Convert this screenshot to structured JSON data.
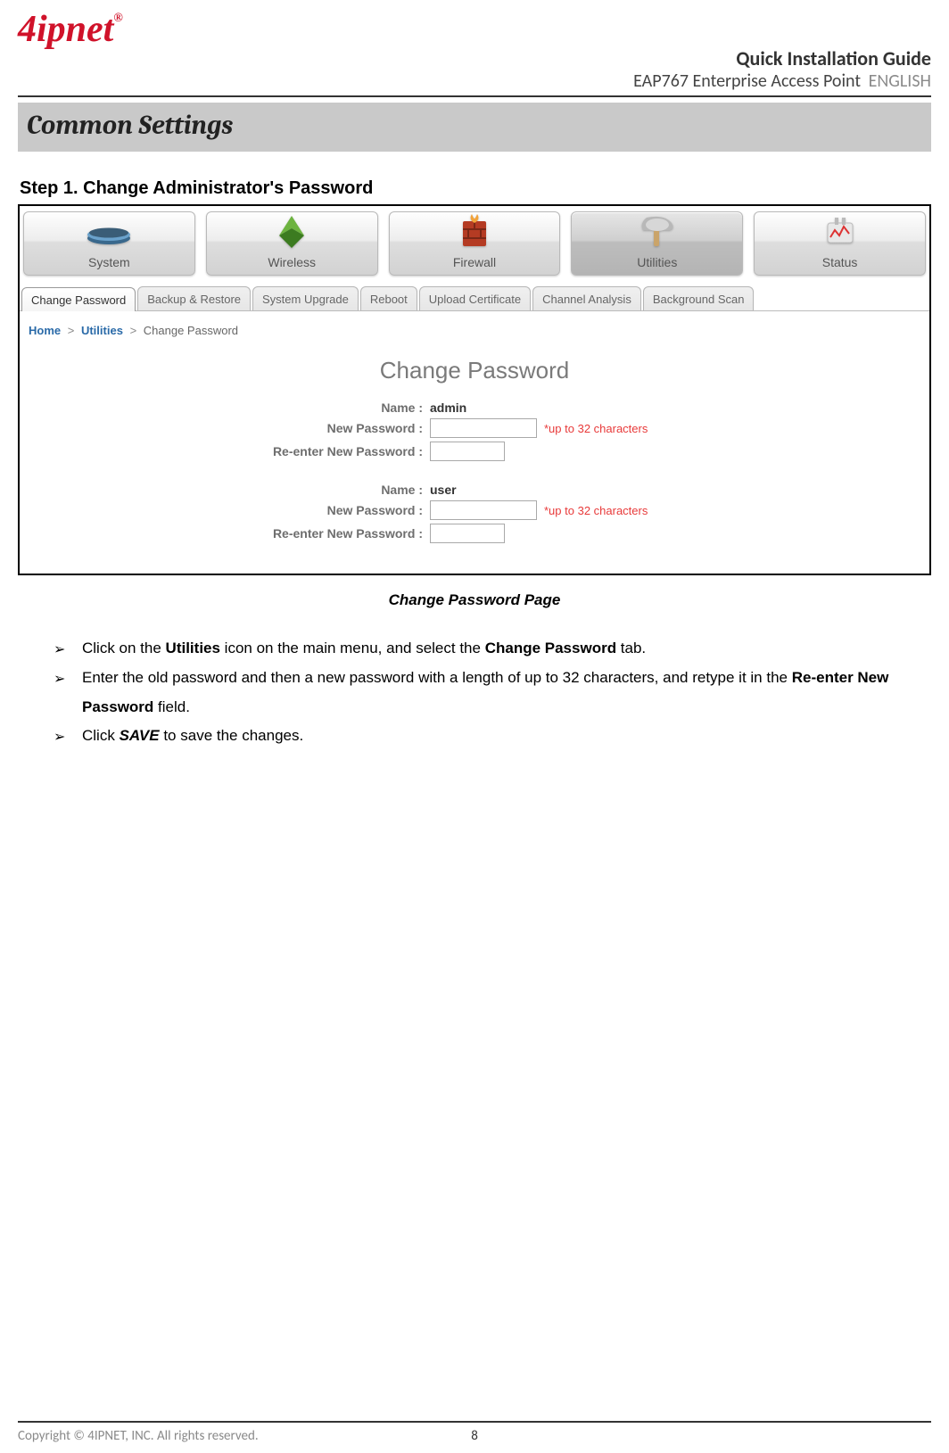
{
  "brand": "4ipnet",
  "brand_tm": "®",
  "header": {
    "qig": "Quick Installation Guide",
    "product": "EAP767 Enterprise Access Point",
    "lang": "ENGLISH"
  },
  "section_title": "Common Settings",
  "step_title": "Step 1. Change Administrator's Password",
  "nav": {
    "items": [
      {
        "label": "System"
      },
      {
        "label": "Wireless"
      },
      {
        "label": "Firewall"
      },
      {
        "label": "Utilities"
      },
      {
        "label": "Status"
      }
    ]
  },
  "tabs": [
    "Change Password",
    "Backup & Restore",
    "System Upgrade",
    "Reboot",
    "Upload Certificate",
    "Channel Analysis",
    "Background Scan"
  ],
  "breadcrumb": {
    "home": "Home",
    "mid": "Utilities",
    "tail": "Change Password"
  },
  "form": {
    "heading": "Change Password",
    "labels": {
      "name": "Name :",
      "newpw": "New Password :",
      "reenter": "Re-enter New Password :"
    },
    "note": "*up to 32 characters",
    "user1": "admin",
    "user2": "user"
  },
  "caption": "Change Password Page",
  "bullets": {
    "b1a": "Click on the ",
    "b1_bold1": "Utilities",
    "b1b": " icon on the main menu, and select the ",
    "b1_bold2": "Change Password",
    "b1c": " tab.",
    "b2a": "Enter the old password and then a new password with a length of up to 32 characters, and retype it in the ",
    "b2_bold": "Re-enter New Password",
    "b2b": " field.",
    "b3a": "Click ",
    "b3_bi": "SAVE",
    "b3b": " to save the changes."
  },
  "footer": {
    "copyright": "Copyright © 4IPNET, INC. All rights reserved.",
    "page": "8"
  }
}
